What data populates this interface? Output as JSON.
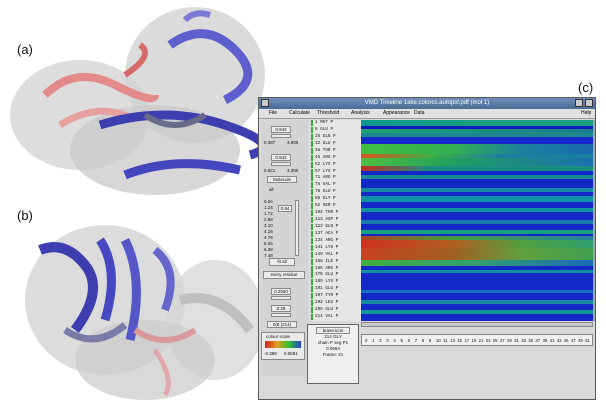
{
  "panels": {
    "a": "(a)",
    "b": "(b)",
    "c": "(c)"
  },
  "window": {
    "title": "VMD Timeline  1ake.colorcs.autopsf.pdf (mol 1)",
    "menu": [
      "File",
      "Calculate",
      "Threshold",
      "Analysis",
      "Appearance",
      "Data",
      "Help"
    ]
  },
  "controls": {
    "val1": "0.942",
    "range1_min": "0.387",
    "range1_max": "3.999",
    "val2": "0.942",
    "range2_min": "0.821",
    "range2_max": "3.390",
    "select_mode": "Molecule",
    "all_label": "all",
    "scale_values": [
      "0.0e",
      "1.24",
      "1.72",
      "2.58",
      "3.10",
      "4.16",
      "4.76",
      "6.05",
      "6.38",
      "7.48"
    ],
    "scale_box": "0.94",
    "fit_all": "fit all",
    "every_residue": "every residue",
    "val3": "0.2580",
    "val4": "0.28",
    "frame_range": "0(6 (214)",
    "color_title": "colour scale",
    "color_min": "-0.388",
    "color_max": "0.0681"
  },
  "residues": [
    "1 MET P",
    "8 GLU P",
    "25 GLN P",
    "32 GLU P",
    "36 THR P",
    "45 ARG P",
    "52 LYS P",
    "57 LYS P",
    "71 ARG P",
    "76 VAL P",
    "78 GLU P",
    "85 GLY P",
    "92 SER P",
    "104 THR P",
    "113 ASP P",
    "123 GLN P",
    "137 ACA P",
    "134 ARG P",
    "141 LYS P",
    "149 VAL P",
    "158 ILE P",
    "165 ARG P",
    "176 GLU P",
    "189 LYS P",
    "191 GLU P",
    "197 TYR P",
    "202 LEU P",
    "206 GLU P",
    "214 VAL P"
  ],
  "info": {
    "button": "brass-icon",
    "res": "214 GLY",
    "chain": "chain P seg P1",
    "value": "0.0694",
    "frame": "Frame: 21"
  },
  "frames": [
    "0",
    "1",
    "2",
    "3",
    "4",
    "5",
    "6",
    "7",
    "8",
    "9",
    "10",
    "11",
    "13",
    "15",
    "17",
    "19",
    "21",
    "23",
    "25",
    "27",
    "29",
    "31",
    "33",
    "35",
    "37",
    "39",
    "41",
    "43",
    "45",
    "47",
    "49",
    "51"
  ],
  "colors": {
    "heat_base": "#1428c8",
    "titlebar": "#4a6a97"
  }
}
